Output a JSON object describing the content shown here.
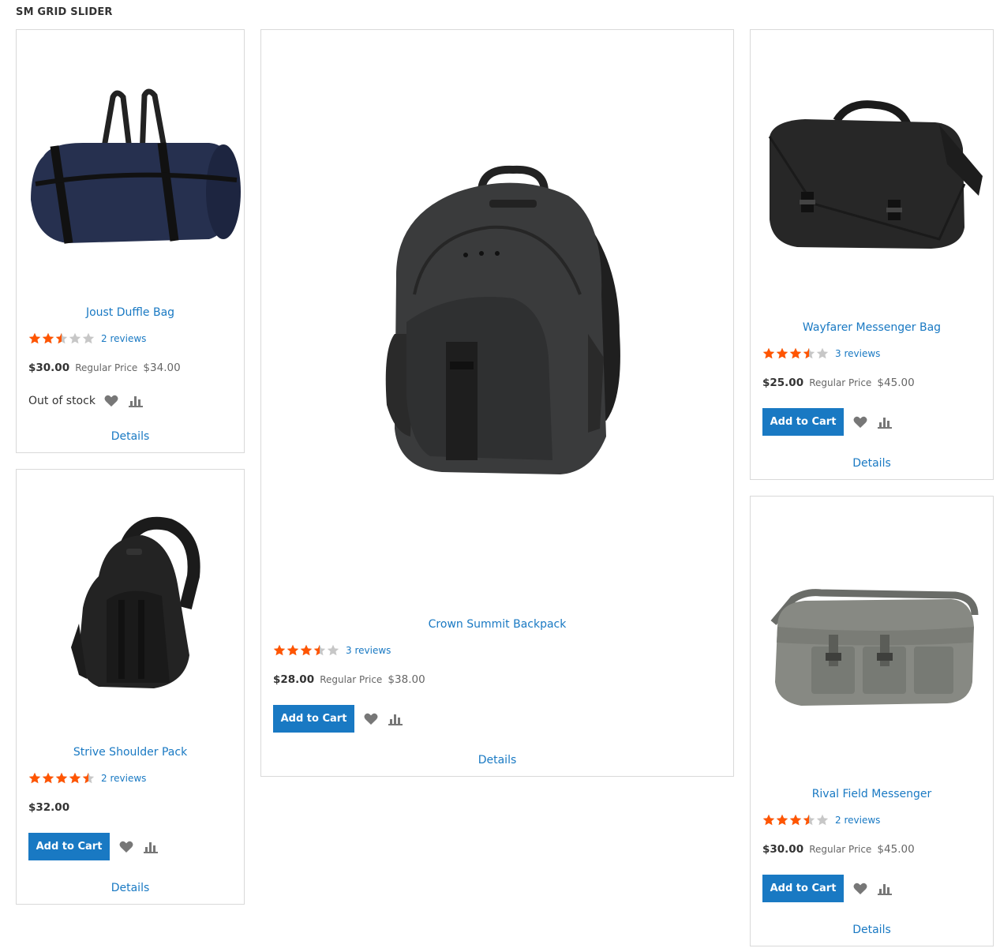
{
  "widget": {
    "title": "SM GRID SLIDER"
  },
  "colors": {
    "link": "#1979c3",
    "star_on": "#ff5501",
    "star_off": "#c7c7c7",
    "button": "#1979c3"
  },
  "products": [
    {
      "name": "Joust Duffle Bag",
      "rating": 2.5,
      "reviews": "2 reviews",
      "price": "$30.00",
      "regular_label": "Regular Price",
      "regular_price": "$34.00",
      "stock": "Out of stock",
      "image_icon": "duffle-bag",
      "details": "Details"
    },
    {
      "name": "Crown Summit Backpack",
      "rating": 3.5,
      "reviews": "3 reviews",
      "price": "$28.00",
      "regular_label": "Regular Price",
      "regular_price": "$38.00",
      "add_to_cart": "Add to Cart",
      "image_icon": "backpack",
      "details": "Details"
    },
    {
      "name": "Wayfarer Messenger Bag",
      "rating": 3.5,
      "reviews": "3 reviews",
      "price": "$25.00",
      "regular_label": "Regular Price",
      "regular_price": "$45.00",
      "add_to_cart": "Add to Cart",
      "image_icon": "messenger-bag",
      "details": "Details"
    },
    {
      "name": "Strive Shoulder Pack",
      "rating": 4.5,
      "reviews": "2 reviews",
      "price": "$32.00",
      "add_to_cart": "Add to Cart",
      "image_icon": "sling-pack",
      "details": "Details"
    },
    {
      "name": "Rival Field Messenger",
      "rating": 3.5,
      "reviews": "2 reviews",
      "price": "$30.00",
      "regular_label": "Regular Price",
      "regular_price": "$45.00",
      "add_to_cart": "Add to Cart",
      "image_icon": "field-messenger",
      "details": "Details"
    }
  ]
}
